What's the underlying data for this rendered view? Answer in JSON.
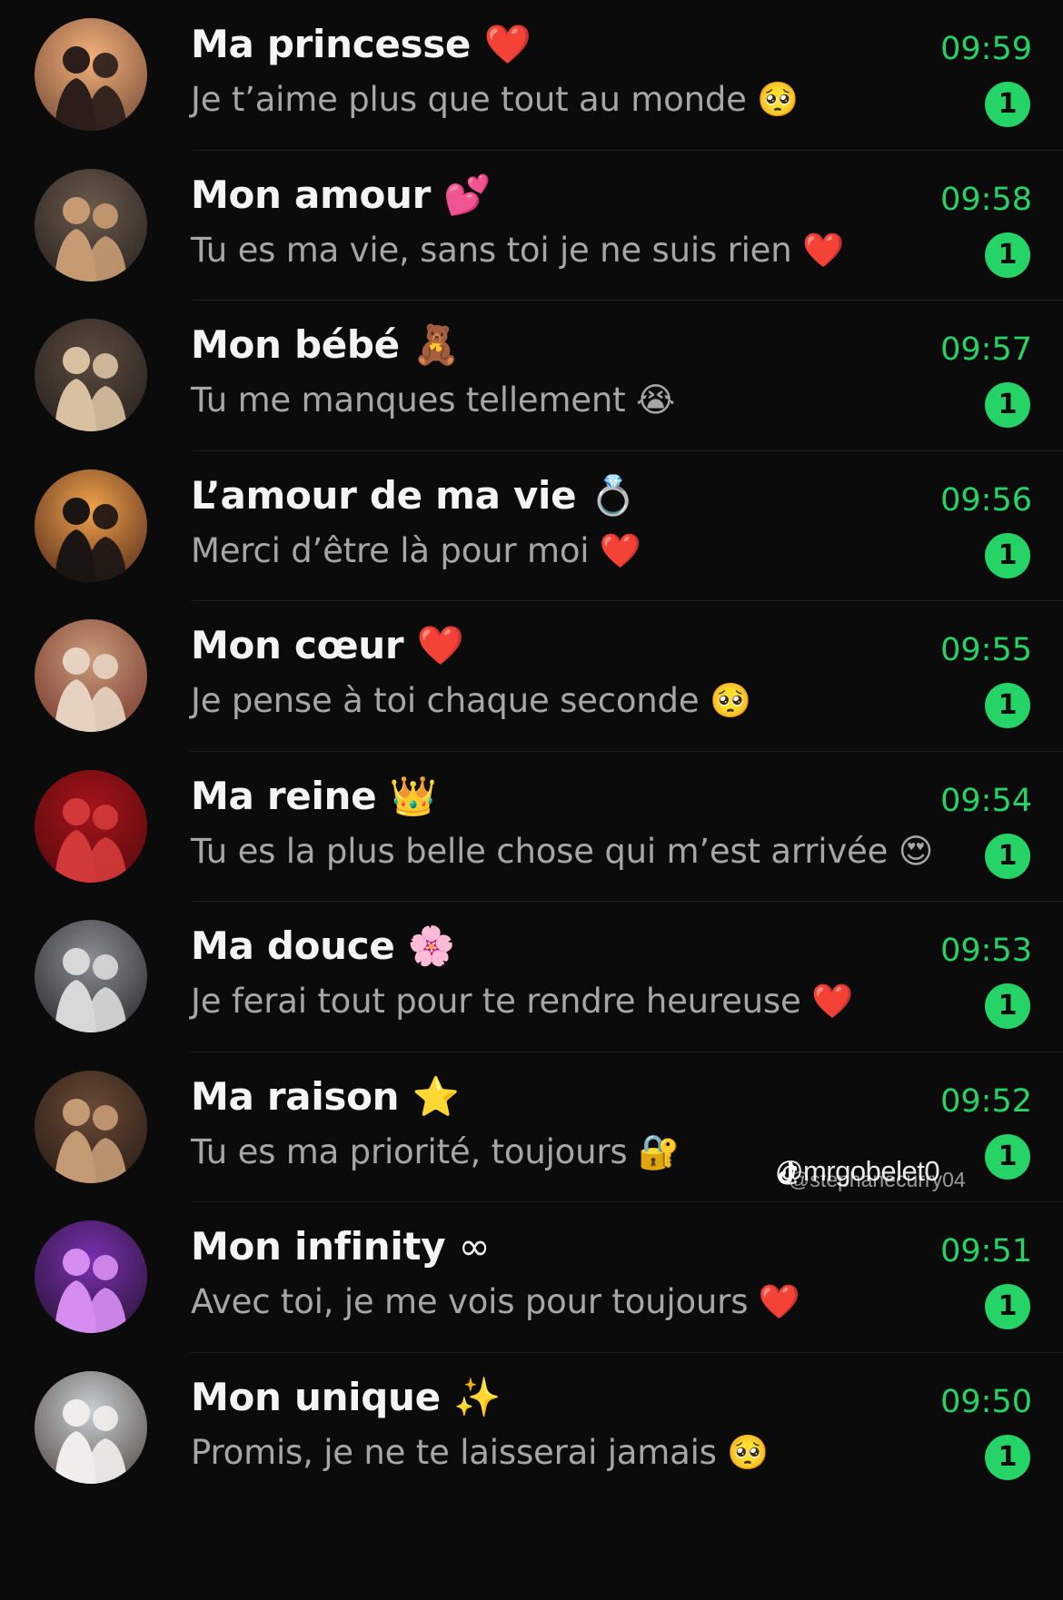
{
  "colors": {
    "background": "#0b0b0b",
    "accent": "#25d366",
    "name_text": "#f4f4f4",
    "preview_text": "#a6a6a6",
    "divider": "#1f1f1f"
  },
  "chats": [
    {
      "name": "Ma princesse",
      "name_emoji": "❤️",
      "name_emoji_icon": "red-heart-icon",
      "preview": "Je t’aime plus que tout au monde",
      "preview_emoji": "🥺",
      "preview_emoji_icon": "pleading-face-icon",
      "time": "09:59",
      "unread": "1",
      "avatar": "couple-sunset-avatar"
    },
    {
      "name": "Mon amour",
      "name_emoji": "💕",
      "name_emoji_icon": "two-hearts-icon",
      "preview": "Tu es ma vie, sans toi je ne suis rien",
      "preview_emoji": "❤️",
      "preview_emoji_icon": "red-heart-icon",
      "time": "09:58",
      "unread": "1",
      "avatar": "couple-embrace-avatar"
    },
    {
      "name": "Mon bébé",
      "name_emoji": "🧸",
      "name_emoji_icon": "teddy-bear-icon",
      "preview": "Tu me manques tellement",
      "preview_emoji": "😭",
      "preview_emoji_icon": "crying-face-icon",
      "time": "09:57",
      "unread": "1",
      "avatar": "couple-portrait-avatar"
    },
    {
      "name": "L’amour de ma vie",
      "name_emoji": "💍",
      "name_emoji_icon": "ring-icon",
      "preview": "Merci d’être là pour moi",
      "preview_emoji": "❤️",
      "preview_emoji_icon": "red-heart-icon",
      "time": "09:56",
      "unread": "1",
      "avatar": "couple-silhouette-avatar"
    },
    {
      "name": "Mon cœur",
      "name_emoji": "❤️",
      "name_emoji_icon": "red-heart-icon",
      "preview": "Je pense à toi chaque seconde",
      "preview_emoji": "🥺",
      "preview_emoji_icon": "pleading-face-icon",
      "time": "09:55",
      "unread": "1",
      "avatar": "couple-hug-avatar"
    },
    {
      "name": "Ma reine",
      "name_emoji": "👑",
      "name_emoji_icon": "crown-icon",
      "preview": "Tu es la plus belle chose qui m’est arrivée",
      "preview_emoji": "😍",
      "preview_emoji_icon": "heart-eyes-icon",
      "time": "09:54",
      "unread": "1",
      "avatar": "red-roses-avatar"
    },
    {
      "name": "Ma douce",
      "name_emoji": "🌸",
      "name_emoji_icon": "cherry-blossom-icon",
      "preview": "Je ferai tout pour te rendre heureuse",
      "preview_emoji": "❤️",
      "preview_emoji_icon": "red-heart-icon",
      "time": "09:53",
      "unread": "1",
      "avatar": "couple-winter-avatar"
    },
    {
      "name": "Ma raison",
      "name_emoji": "⭐",
      "name_emoji_icon": "star-icon",
      "preview": "Tu es ma priorité, toujours",
      "preview_emoji": "🔐",
      "preview_emoji_icon": "lock-with-key-icon",
      "time": "09:52",
      "unread": "1",
      "avatar": "couple-window-avatar"
    },
    {
      "name": "Mon infinity",
      "name_emoji": "∞",
      "name_emoji_icon": "infinity-icon",
      "preview": "Avec toi, je me vois pour toujours",
      "preview_emoji": "❤️",
      "preview_emoji_icon": "red-heart-icon",
      "time": "09:51",
      "unread": "1",
      "avatar": "couple-neon-avatar"
    },
    {
      "name": "Mon unique",
      "name_emoji": "✨",
      "name_emoji_icon": "sparkles-icon",
      "preview": "Promis, je ne te laisserai jamais",
      "preview_emoji": "🥺",
      "preview_emoji_icon": "pleading-face-icon",
      "time": "09:50",
      "unread": "1",
      "avatar": "couple-lake-avatar"
    }
  ],
  "watermark": {
    "handle": "@mrgobelet0",
    "sub_handle": "@stephanecurry04",
    "icon": "tiktok-logo-icon"
  }
}
